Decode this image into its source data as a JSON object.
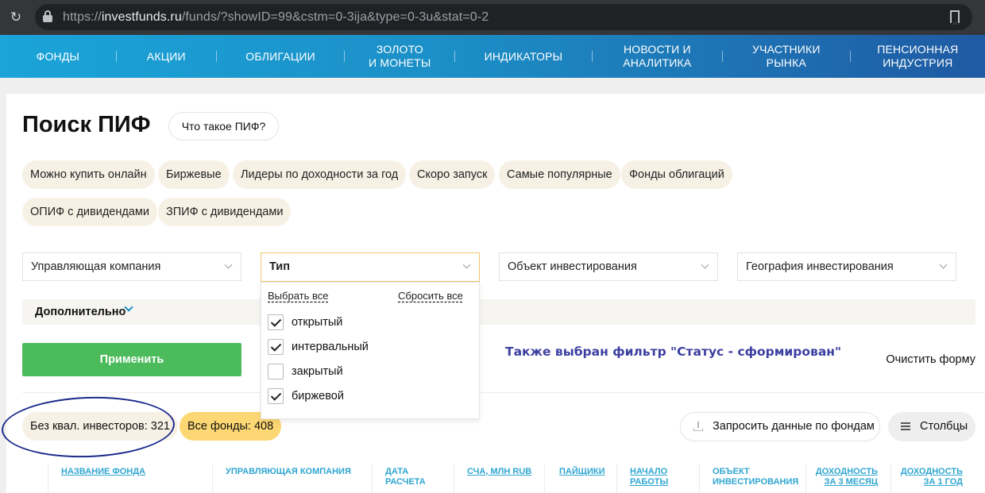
{
  "browser": {
    "url_prefix": "https://",
    "url_host": "investfunds.ru",
    "url_path": "/funds/?showID=99&cstm=0-3ija&type=0-3u&stat=0-2",
    "icons": {
      "reload": "reload-icon",
      "lock": "lock-icon",
      "bookmark": "bookmark-icon"
    }
  },
  "nav": {
    "items": [
      {
        "line1": "ФОНДЫ",
        "line2": ""
      },
      {
        "line1": "АКЦИИ",
        "line2": ""
      },
      {
        "line1": "ОБЛИГАЦИИ",
        "line2": ""
      },
      {
        "line1": "ЗОЛОТО",
        "line2": "И МОНЕТЫ"
      },
      {
        "line1": "ИНДИКАТОРЫ",
        "line2": ""
      },
      {
        "line1": "НОВОСТИ И",
        "line2": "АНАЛИТИКА"
      },
      {
        "line1": "УЧАСТНИКИ",
        "line2": "РЫНКА"
      },
      {
        "line1": "ПЕНСИОННАЯ",
        "line2": "ИНДУСТРИЯ"
      }
    ]
  },
  "page": {
    "title": "Поиск ПИФ",
    "what_is_button": "Что такое ПИФ?"
  },
  "quick_filters": [
    "Можно купить онлайн",
    "Биржевые",
    "Лидеры по доходности за год",
    "Скоро запуск",
    "Самые популярные",
    "Фонды облигаций",
    "ОПИФ с дивидендами",
    "ЗПИФ с дивидендами"
  ],
  "selects": {
    "company": "Управляющая компания",
    "type": "Тип",
    "object": "Объект инвестирования",
    "geography": "География инвестирования"
  },
  "type_dropdown": {
    "select_all": "Выбрать все",
    "reset_all": "Сбросить все",
    "options": [
      {
        "label": "открытый",
        "checked": true
      },
      {
        "label": "интервальный",
        "checked": true
      },
      {
        "label": "закрытый",
        "checked": false
      },
      {
        "label": "биржевой",
        "checked": true
      }
    ]
  },
  "extra": {
    "label": "Дополнительно"
  },
  "actions": {
    "apply": "Применить",
    "clear_form": "Очистить форму",
    "notice": "Также выбран фильтр \"Статус - сформирован\""
  },
  "counts": {
    "non_qualified": "Без квал. инвесторов: 321",
    "all_funds": "Все фонды: 408"
  },
  "toolbar": {
    "request_data": "Запросить данные по фондам",
    "columns": "Столбцы"
  },
  "table": {
    "headers": [
      {
        "line1": "НАЗВАНИЕ ФОНДА",
        "line2": ""
      },
      {
        "line1": "УПРАВЛЯЮЩАЯ КОМПАНИЯ",
        "line2": ""
      },
      {
        "line1": "ДАТА",
        "line2": "РАСЧЕТА"
      },
      {
        "line1": "СЧА, МЛН RUB",
        "line2": ""
      },
      {
        "line1": "ПАЙЩИКИ",
        "line2": ""
      },
      {
        "line1": "НАЧАЛО",
        "line2": "РАБОТЫ"
      },
      {
        "line1": "ОБЪЕКТ",
        "line2": "ИНВЕСТИРОВАНИЯ"
      },
      {
        "line1": "ДОХОДНОСТЬ",
        "line2": "ЗА 3 МЕСЯЦ"
      },
      {
        "line1": "ДОХОДНОСТЬ",
        "line2": "ЗА 1 ГОД"
      }
    ]
  },
  "colors": {
    "nav_start": "#1aa4d8",
    "nav_end": "#1f5aa3",
    "apply_green": "#4cbb5c",
    "chip_beige": "#f7f1e5",
    "all_funds_yellow": "#fcd773",
    "notice_blue": "#3b3fa0",
    "header_link": "#2fa6d1",
    "annotation_circle": "#1b2a8c"
  }
}
